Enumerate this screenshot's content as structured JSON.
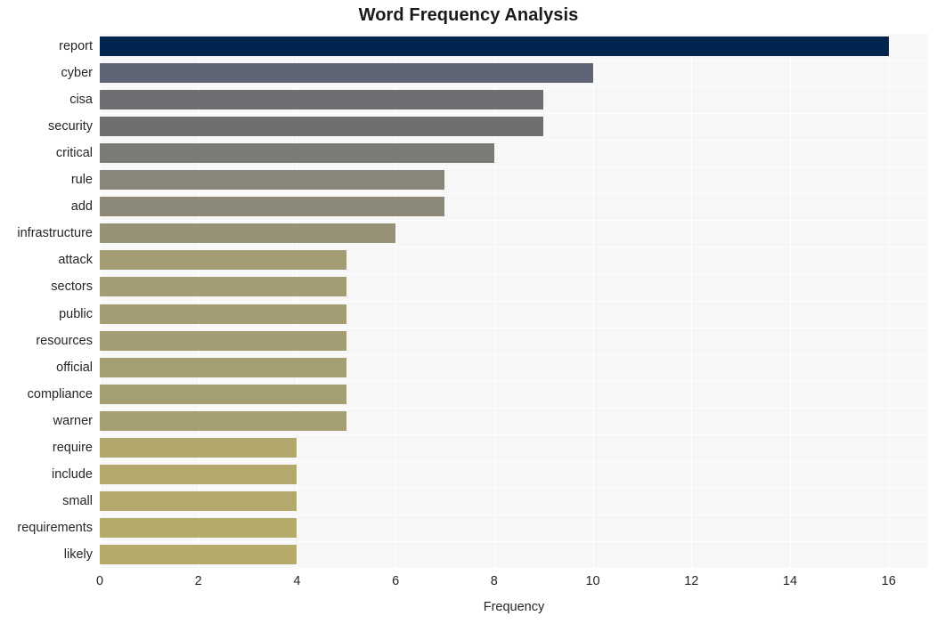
{
  "chart_data": {
    "type": "bar",
    "orientation": "horizontal",
    "title": "Word Frequency Analysis",
    "xlabel": "Frequency",
    "ylabel": "",
    "xlim": [
      0,
      16.8
    ],
    "xticks": [
      0,
      2,
      4,
      6,
      8,
      10,
      12,
      14,
      16
    ],
    "xtick_labels": [
      "0",
      "2",
      "4",
      "6",
      "8",
      "10",
      "12",
      "14",
      "16"
    ],
    "grid": true,
    "legend": null,
    "plot_background": "#f7f7f7",
    "figure_background": "#ffffff",
    "categories": [
      "report",
      "cyber",
      "cisa",
      "security",
      "critical",
      "rule",
      "add",
      "infrastructure",
      "attack",
      "sectors",
      "public",
      "resources",
      "official",
      "compliance",
      "warner",
      "require",
      "include",
      "small",
      "requirements",
      "likely"
    ],
    "values": [
      16,
      10,
      9,
      9,
      8,
      7,
      7,
      6,
      5,
      5,
      5,
      5,
      5,
      5,
      5,
      4,
      4,
      4,
      4,
      4
    ],
    "bar_colors": [
      "#01254f",
      "#5e6473",
      "#6c6e72",
      "#6d6f71",
      "#7b7b76",
      "#88867a",
      "#8b8878",
      "#969177",
      "#a39c74",
      "#a49d74",
      "#a49d74",
      "#a49d74",
      "#a59e73",
      "#a59e73",
      "#a59e73",
      "#b2a86e",
      "#b3a96d",
      "#b3a96d",
      "#b4aa6c",
      "#b5aa6c"
    ]
  }
}
